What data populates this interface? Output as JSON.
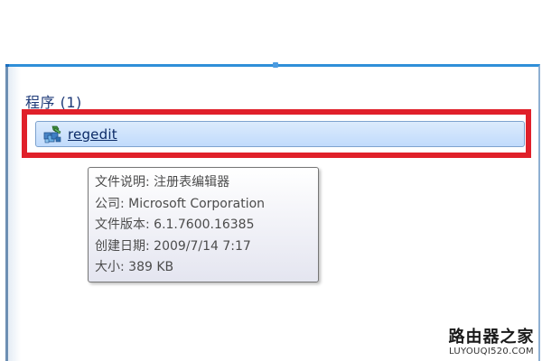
{
  "search_results": {
    "group_title": "程序 (1)",
    "result": {
      "name": "regedit",
      "icon": "registry-editor-icon"
    }
  },
  "tooltip": {
    "description": "文件说明: 注册表编辑器",
    "company": "公司: Microsoft Corporation",
    "version": "文件版本: 6.1.7600.16385",
    "created": "创建日期: 2009/7/14 7:17",
    "size": "大小: 389 KB"
  },
  "watermark": {
    "logo": "路由器之家",
    "url": "LUYOUQI520.COM"
  },
  "colors": {
    "highlight_border": "#e0202a",
    "selection_fill": "#c1dbfc",
    "group_title": "#1e3a78",
    "panel_border": "#2f8fd8"
  }
}
